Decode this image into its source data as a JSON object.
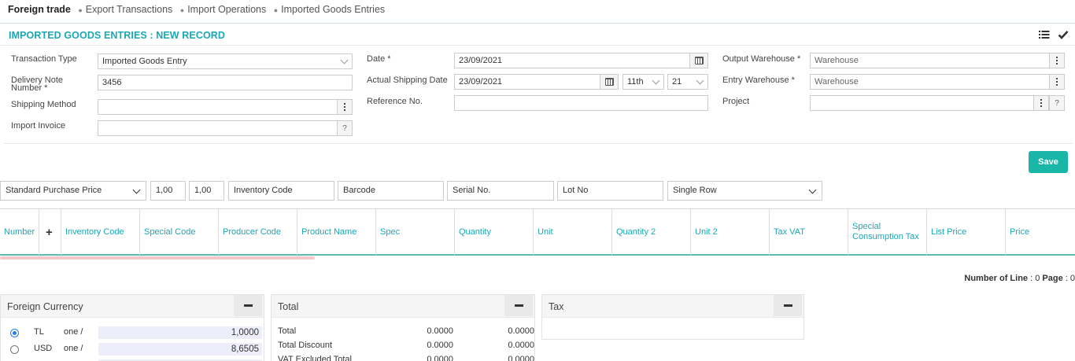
{
  "breadcrumb": {
    "root": "Foreign trade",
    "items": [
      "Export Transactions",
      "Import Operations",
      "Imported Goods Entries"
    ]
  },
  "page": {
    "title": "IMPORTED GOODS ENTRIES : NEW RECORD"
  },
  "icons": {
    "list": "list-icon",
    "confirm": "check-icon"
  },
  "form": {
    "transaction_type": {
      "label": "Transaction Type",
      "value": "Imported Goods Entry"
    },
    "delivery_note": {
      "label": "Delivery Note Number *",
      "value": "3456"
    },
    "shipping_method": {
      "label": "Shipping Method",
      "value": ""
    },
    "import_invoice": {
      "label": "Import Invoice",
      "value": "",
      "help": "?"
    },
    "date": {
      "label": "Date *",
      "value": "23/09/2021"
    },
    "actual_shipping_date": {
      "label": "Actual Shipping Date",
      "value": "23/09/2021",
      "hour": "11th",
      "minute": "21"
    },
    "reference_no": {
      "label": "Reference No.",
      "value": ""
    },
    "output_warehouse": {
      "label": "Output Warehouse *",
      "placeholder": "Warehouse"
    },
    "entry_warehouse": {
      "label": "Entry Warehouse *",
      "placeholder": "Warehouse"
    },
    "project": {
      "label": "Project",
      "value": "",
      "help": "?"
    }
  },
  "toolbar": {
    "save_label": "Save"
  },
  "filters": {
    "price_type": "Standard Purchase Price",
    "multiplier1": "1,00",
    "multiplier2": "1,00",
    "inventory_code": "Inventory Code",
    "barcode": "Barcode",
    "serial_no": "Serial No.",
    "lot_no": "Lot No",
    "row_mode": "Single Row"
  },
  "grid": {
    "columns": [
      "Number",
      "+",
      "Inventory Code",
      "Special Code",
      "Producer Code",
      "Product Name",
      "Spec",
      "Quantity",
      "Unit",
      "Quantity 2",
      "Unit 2",
      "Tax VAT",
      "Special Consumption Tax",
      "List Price",
      "Price"
    ]
  },
  "line_info": {
    "lines_label": "Number of Line",
    "lines": "0",
    "page_label": "Page",
    "page": "0"
  },
  "foreign_currency": {
    "title": "Foreign Currency",
    "rows": [
      {
        "code": "TL",
        "per": "one /",
        "rate": "1,0000",
        "selected": true
      },
      {
        "code": "USD",
        "per": "one /",
        "rate": "8,6505",
        "selected": false
      }
    ]
  },
  "totals": {
    "title": "Total",
    "rows": [
      {
        "label": "Total",
        "v1": "0.0000",
        "v2": "0.0000"
      },
      {
        "label": "Total Discount",
        "v1": "0.0000",
        "v2": "0.0000"
      },
      {
        "label": "VAT Excluded Total",
        "v1": "0.0000",
        "v2": "0.0000"
      }
    ]
  },
  "tax": {
    "title": "Tax"
  }
}
